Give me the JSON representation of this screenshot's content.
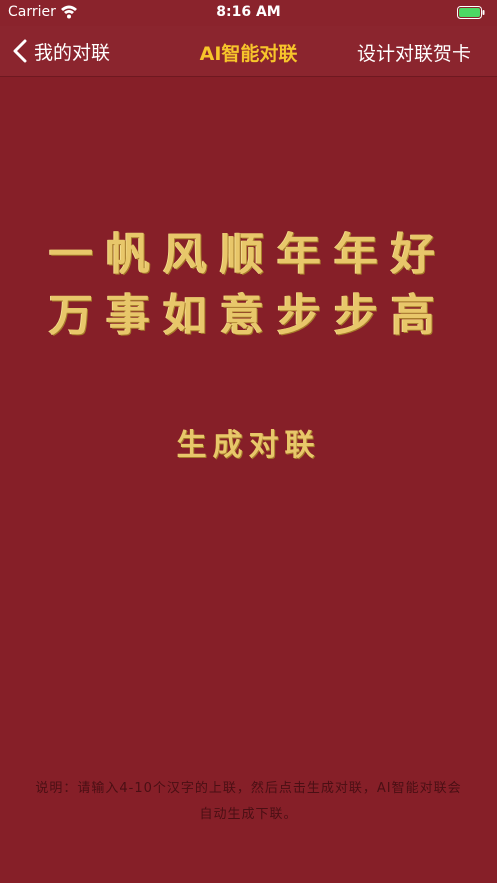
{
  "status_bar": {
    "carrier": "Carrier",
    "time": "8:16 AM",
    "wifi_icon": "wifi-icon",
    "battery_icon": "battery-icon"
  },
  "nav": {
    "back_label": "我的对联",
    "back_icon": "chevron-left-icon",
    "title": "AI智能对联",
    "right_label": "设计对联贺卡",
    "title_color": "#f7c52b"
  },
  "couplet": {
    "first_line": "一帆风顺年年好",
    "second_line": "万事如意步步高",
    "color": "#e8c76a"
  },
  "generate_button": {
    "label": "生成对联"
  },
  "note": {
    "text": "说明：请输入4-10个汉字的上联，然后点击生成对联，AI智能对联会自动生成下联。"
  },
  "colors": {
    "background": "#861f28"
  }
}
